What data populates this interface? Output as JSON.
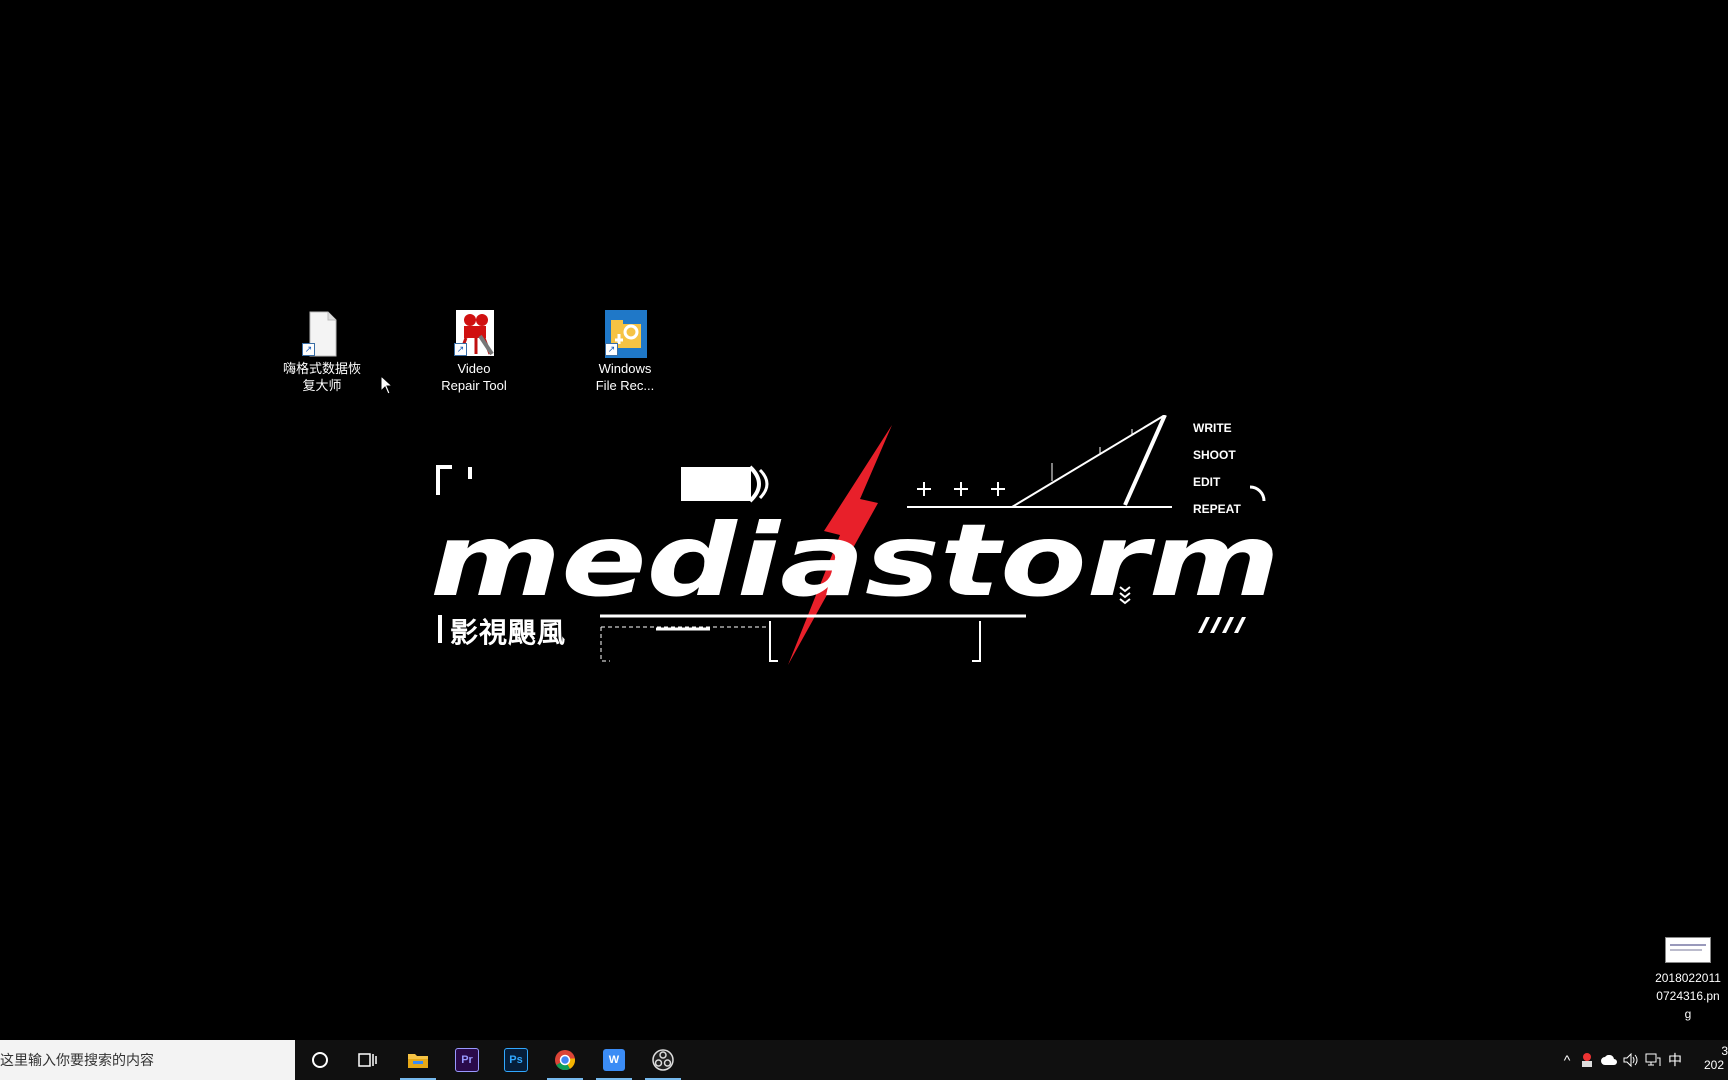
{
  "desktop": {
    "icons": [
      {
        "label_line1": "嗨格式数据恢",
        "label_line2": "复大师",
        "icon": "blank-document-icon"
      },
      {
        "label_line1": "Video",
        "label_line2": "Repair Tool",
        "icon": "movie-camera-repair-icon"
      },
      {
        "label_line1": "Windows",
        "label_line2": "File Rec...",
        "icon": "file-recovery-icon"
      }
    ],
    "file_on_right": {
      "line1": "2018022011",
      "line2": "0724316.pn",
      "line3": "g"
    }
  },
  "wallpaper": {
    "brand": "mediastorm",
    "chinese_name": "影視颶風",
    "menu_words": [
      "WRITE",
      "SHOOT",
      "EDIT",
      "REPEAT"
    ],
    "accent_color": "#e8202a"
  },
  "taskbar": {
    "search_placeholder": "在这里输入你要搜索的内容",
    "apps": [
      {
        "name": "file-explorer",
        "label": ""
      },
      {
        "name": "premiere-pro",
        "label": "Pr",
        "color": "#2a0a4a",
        "text_color": "#9999ff"
      },
      {
        "name": "photoshop",
        "label": "Ps",
        "color": "#061e3a",
        "text_color": "#31a8ff"
      },
      {
        "name": "chrome",
        "label": ""
      },
      {
        "name": "wps",
        "label": "W",
        "color": "#3b8cf5",
        "text_color": "#ffffff"
      },
      {
        "name": "obs",
        "label": ""
      }
    ],
    "tray": {
      "ime": "中",
      "clock_line1": "3",
      "clock_line2": "202"
    }
  }
}
